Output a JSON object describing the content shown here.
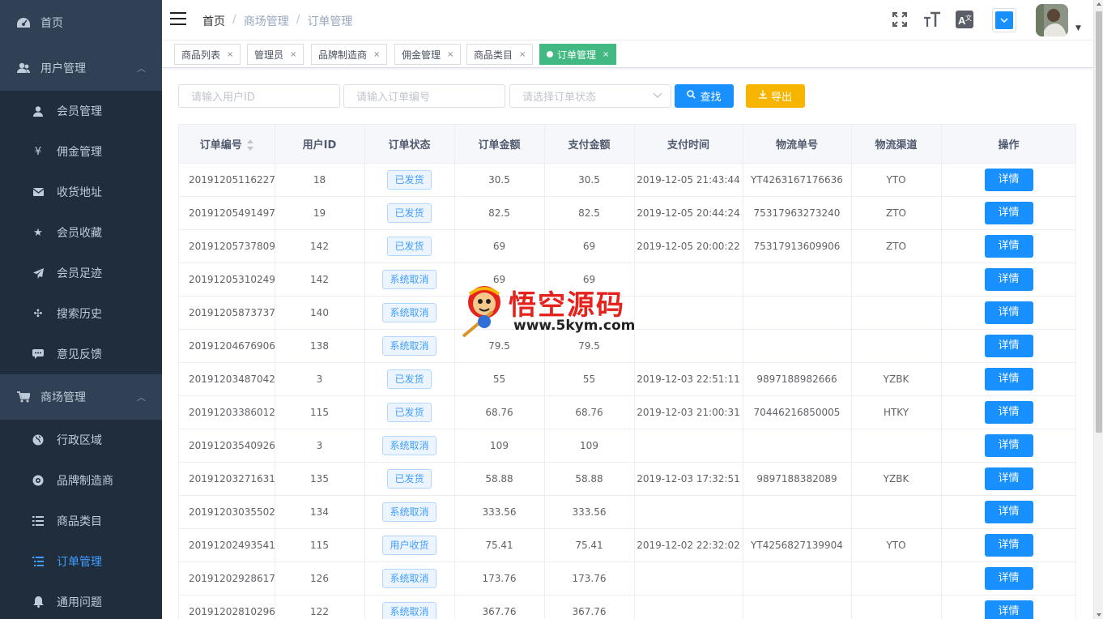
{
  "sidebar": {
    "top_item": {
      "label": "首页",
      "icon": "dashboard-icon"
    },
    "groups": [
      {
        "label": "用户管理",
        "icon": "user-group-icon",
        "arrow": "︿",
        "items": [
          {
            "label": "会员管理",
            "icon": "user-icon",
            "glyph": "👤"
          },
          {
            "label": "佣金管理",
            "icon": "yen-icon",
            "glyph": "¥"
          },
          {
            "label": "收货地址",
            "icon": "envelope-icon",
            "glyph": "✉"
          },
          {
            "label": "会员收藏",
            "icon": "star-icon",
            "glyph": "★"
          },
          {
            "label": "会员足迹",
            "icon": "send-icon",
            "glyph": "✈"
          },
          {
            "label": "搜索历史",
            "icon": "move-icon",
            "glyph": "✣"
          },
          {
            "label": "意见反馈",
            "icon": "comment-icon",
            "glyph": "▣"
          }
        ]
      },
      {
        "label": "商场管理",
        "icon": "cart-icon",
        "arrow": "︿",
        "items": [
          {
            "label": "行政区域",
            "icon": "globe-icon",
            "glyph": "◉"
          },
          {
            "label": "品牌制造商",
            "icon": "compass-icon",
            "glyph": "✪"
          },
          {
            "label": "商品类目",
            "icon": "list-icon",
            "glyph": "☰"
          },
          {
            "label": "订单管理",
            "icon": "order-list-icon",
            "glyph": "☷"
          },
          {
            "label": "通用问题",
            "icon": "bell-icon",
            "glyph": "🔔"
          }
        ]
      }
    ]
  },
  "header": {
    "breadcrumb": [
      "首页",
      "商场管理",
      "订单管理"
    ],
    "icons": [
      "fullscreen-icon",
      "font-size-icon",
      "translate-icon"
    ]
  },
  "tags": [
    {
      "label": "商品列表",
      "close": "×"
    },
    {
      "label": "管理员",
      "close": "×"
    },
    {
      "label": "品牌制造商",
      "close": "×"
    },
    {
      "label": "佣金管理",
      "close": "×"
    },
    {
      "label": "商品类目",
      "close": "×"
    },
    {
      "label": "订单管理",
      "close": "×",
      "active": true
    }
  ],
  "filters": {
    "user_id_placeholder": "请输入用户ID",
    "order_no_placeholder": "请输入订单编号",
    "status_placeholder": "请选择订单状态",
    "search_label": "查找",
    "export_label": "导出"
  },
  "table": {
    "columns": [
      "订单编号",
      "用户ID",
      "订单状态",
      "订单金额",
      "支付金额",
      "支付时间",
      "物流单号",
      "物流渠道",
      "操作"
    ],
    "detail_label": "详情",
    "rows": [
      [
        "20191205116227",
        "18",
        "已发货",
        "30.5",
        "30.5",
        "2019-12-05 21:43:44",
        "YT4263167176636",
        "YTO"
      ],
      [
        "20191205491497",
        "19",
        "已发货",
        "82.5",
        "82.5",
        "2019-12-05 20:44:24",
        "75317963273240",
        "ZTO"
      ],
      [
        "20191205737809",
        "142",
        "已发货",
        "69",
        "69",
        "2019-12-05 20:00:22",
        "75317913609906",
        "ZTO"
      ],
      [
        "20191205310249",
        "142",
        "系统取消",
        "69",
        "69",
        "",
        "",
        ""
      ],
      [
        "20191205873737",
        "140",
        "系统取消",
        "",
        "",
        "",
        "",
        ""
      ],
      [
        "20191204676906",
        "138",
        "系统取消",
        "79.5",
        "79.5",
        "",
        "",
        ""
      ],
      [
        "20191203487042",
        "3",
        "已发货",
        "55",
        "55",
        "2019-12-03 22:51:11",
        "9897188982666",
        "YZBK"
      ],
      [
        "20191203386012",
        "115",
        "已发货",
        "68.76",
        "68.76",
        "2019-12-03 21:00:31",
        "70446216850005",
        "HTKY"
      ],
      [
        "20191203540926",
        "3",
        "系统取消",
        "109",
        "109",
        "",
        "",
        ""
      ],
      [
        "20191203271631",
        "135",
        "已发货",
        "58.88",
        "58.88",
        "2019-12-03 17:32:51",
        "9897188382089",
        "YZBK"
      ],
      [
        "20191203035502",
        "134",
        "系统取消",
        "333.56",
        "333.56",
        "",
        "",
        ""
      ],
      [
        "20191202493541",
        "115",
        "用户收货",
        "75.41",
        "75.41",
        "2019-12-02 22:32:02",
        "YT4256827139904",
        "YTO"
      ],
      [
        "20191202928617",
        "126",
        "系统取消",
        "173.76",
        "173.76",
        "",
        "",
        ""
      ],
      [
        "20191202810296",
        "122",
        "系统取消",
        "367.76",
        "367.76",
        "",
        "",
        ""
      ]
    ]
  },
  "watermark": {
    "title": "悟空源码",
    "url": "www.5kym.com"
  },
  "colors": {
    "sidebar_bg": "#304156",
    "submenu_bg": "#1f2d3d",
    "primary": "#1890ff",
    "active_tag": "#42b983",
    "export": "#f7b500"
  }
}
